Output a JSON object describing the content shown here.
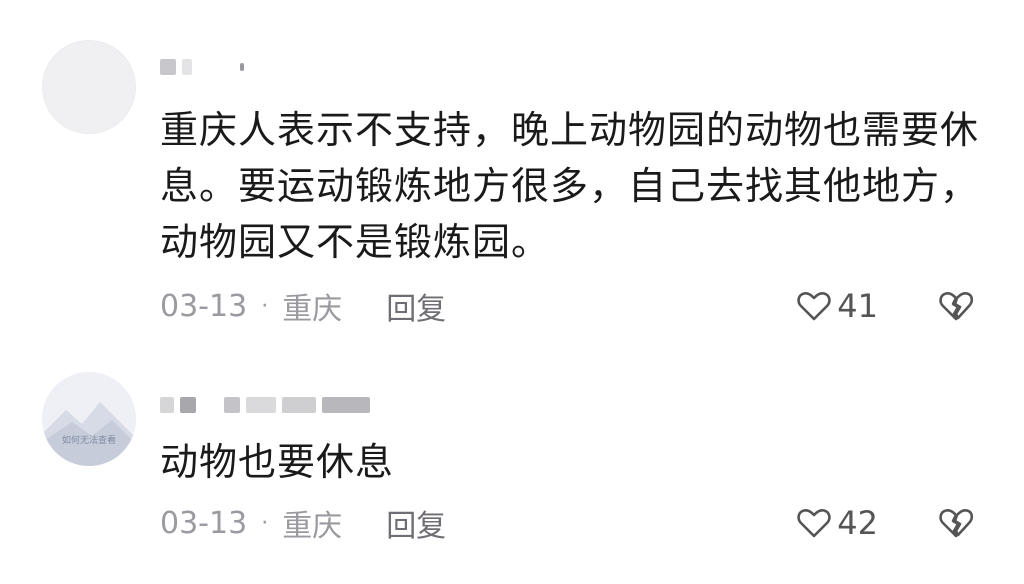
{
  "comments": [
    {
      "text": "重庆人表示不支持，晚上动物园的动物也需要休息。要运动锻炼地方很多，自己去找其他地方，动物园又不是锻炼园。",
      "date": "03-13",
      "location": "重庆",
      "reply_label": "回复",
      "likes": "41",
      "icons": {
        "like": "heart-icon",
        "dislike": "broken-heart-icon"
      }
    },
    {
      "text": "动物也要休息",
      "date": "03-13",
      "location": "重庆",
      "reply_label": "回复",
      "likes": "42",
      "avatar_caption": "如何无法查看",
      "icons": {
        "like": "heart-icon",
        "dislike": "broken-heart-icon"
      }
    }
  ],
  "meta_separator": "·",
  "colors": {
    "text": "#1a1a1a",
    "meta": "#9a9aa0",
    "icon": "#555555"
  }
}
